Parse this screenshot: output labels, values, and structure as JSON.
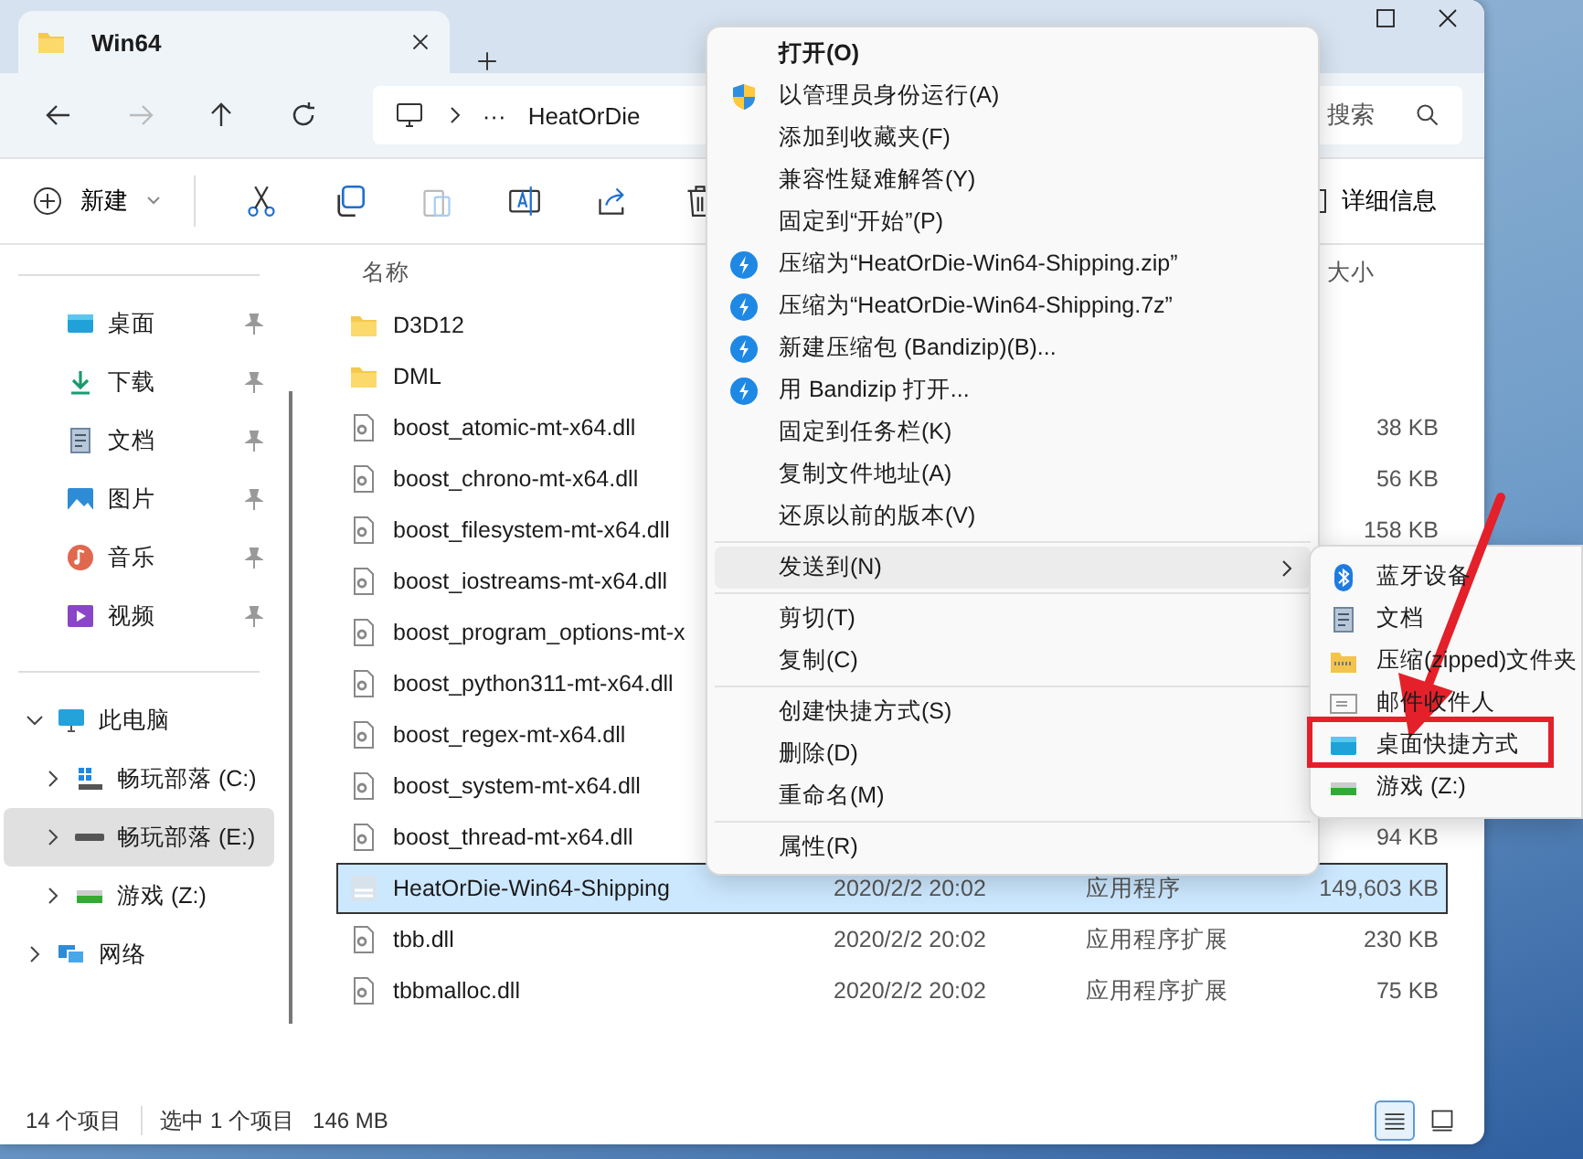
{
  "tabs": [
    {
      "label": "Win64",
      "selected": true
    }
  ],
  "address": {
    "overflow": "···",
    "crumbs": [
      "HeatOrDie"
    ],
    "search_placeholder": "搜索"
  },
  "toolbar": {
    "new_label": "新建",
    "details_label": "详细信息"
  },
  "sidebar": {
    "quick_access": [
      {
        "label": "桌面",
        "kind": "desktop",
        "pinned": true
      },
      {
        "label": "下载",
        "kind": "download",
        "pinned": true
      },
      {
        "label": "文档",
        "kind": "document",
        "pinned": true
      },
      {
        "label": "图片",
        "kind": "picture",
        "pinned": true
      },
      {
        "label": "音乐",
        "kind": "music",
        "pinned": true
      },
      {
        "label": "视频",
        "kind": "video",
        "pinned": true
      }
    ],
    "tree": [
      {
        "label": "此电脑",
        "kind": "pc",
        "expanded": true,
        "selected": false,
        "children": [
          {
            "label": "畅玩部落 (C:)",
            "kind": "windrive",
            "expanded": false,
            "selected": false
          },
          {
            "label": "畅玩部落 (E:)",
            "kind": "drive",
            "expanded": false,
            "selected": true
          },
          {
            "label": "游戏 (Z:)",
            "kind": "netdrive",
            "expanded": false,
            "selected": false
          }
        ]
      },
      {
        "label": "网络",
        "kind": "network",
        "expanded": false,
        "selected": false
      }
    ]
  },
  "file_list": {
    "columns": [
      "名称",
      "大小"
    ],
    "rows": [
      {
        "name": "D3D12",
        "kind": "folder",
        "selected": false
      },
      {
        "name": "DML",
        "kind": "folder",
        "selected": false
      },
      {
        "name": "boost_atomic-mt-x64.dll",
        "kind": "dll",
        "size": "38 KB",
        "selected": false
      },
      {
        "name": "boost_chrono-mt-x64.dll",
        "kind": "dll",
        "size": "56 KB",
        "selected": false
      },
      {
        "name": "boost_filesystem-mt-x64.dll",
        "kind": "dll",
        "size": "158 KB",
        "selected": false
      },
      {
        "name": "boost_iostreams-mt-x64.dll",
        "kind": "dll",
        "selected": false
      },
      {
        "name": "boost_program_options-mt-x",
        "kind": "dll",
        "selected": false
      },
      {
        "name": "boost_python311-mt-x64.dll",
        "kind": "dll",
        "selected": false
      },
      {
        "name": "boost_regex-mt-x64.dll",
        "kind": "dll",
        "selected": false
      },
      {
        "name": "boost_system-mt-x64.dll",
        "kind": "dll",
        "selected": false
      },
      {
        "name": "boost_thread-mt-x64.dll",
        "kind": "dll",
        "size": "94 KB",
        "selected": false
      },
      {
        "name": "HeatOrDie-Win64-Shipping",
        "kind": "exe",
        "date": "2020/2/2 20:02",
        "type": "应用程序",
        "size": "149,603 KB",
        "selected": true
      },
      {
        "name": "tbb.dll",
        "kind": "dll",
        "date": "2020/2/2 20:02",
        "type": "应用程序扩展",
        "size": "230 KB",
        "selected": false
      },
      {
        "name": "tbbmalloc.dll",
        "kind": "dll",
        "date": "2020/2/2 20:02",
        "type": "应用程序扩展",
        "size": "75 KB",
        "selected": false
      }
    ]
  },
  "context_menu": {
    "groups": [
      [
        {
          "label": "打开(O)",
          "kind": "plain",
          "default": true
        },
        {
          "label": "以管理员身份运行(A)",
          "kind": "shield",
          "default": false
        },
        {
          "label": "添加到收藏夹(F)",
          "kind": "plain",
          "default": false
        },
        {
          "label": "兼容性疑难解答(Y)",
          "kind": "plain",
          "default": false
        },
        {
          "label": "固定到“开始”(P)",
          "kind": "plain",
          "default": false
        },
        {
          "label": "压缩为“HeatOrDie-Win64-Shipping.zip”",
          "kind": "bandizip",
          "default": false
        },
        {
          "label": "压缩为“HeatOrDie-Win64-Shipping.7z”",
          "kind": "bandizip",
          "default": false
        },
        {
          "label": "新建压缩包 (Bandizip)(B)...",
          "kind": "bandizip",
          "default": false
        },
        {
          "label": "用 Bandizip 打开...",
          "kind": "bandizip",
          "default": false
        },
        {
          "label": "固定到任务栏(K)",
          "kind": "plain",
          "default": false
        },
        {
          "label": "复制文件地址(A)",
          "kind": "plain",
          "default": false
        },
        {
          "label": "还原以前的版本(V)",
          "kind": "plain",
          "default": false
        }
      ],
      [
        {
          "label": "发送到(N)",
          "kind": "submenu",
          "default": false,
          "selected": true
        }
      ],
      [
        {
          "label": "剪切(T)",
          "kind": "plain",
          "default": false
        },
        {
          "label": "复制(C)",
          "kind": "plain",
          "default": false
        }
      ],
      [
        {
          "label": "创建快捷方式(S)",
          "kind": "plain",
          "default": false
        },
        {
          "label": "删除(D)",
          "kind": "plain",
          "default": false
        },
        {
          "label": "重命名(M)",
          "kind": "plain",
          "default": false
        }
      ],
      [
        {
          "label": "属性(R)",
          "kind": "plain",
          "default": false
        }
      ]
    ]
  },
  "send_to_menu": [
    {
      "label": "蓝牙设备",
      "kind": "bluetooth"
    },
    {
      "label": "文档",
      "kind": "document"
    },
    {
      "label": "压缩(zipped)文件夹",
      "kind": "zip"
    },
    {
      "label": "邮件收件人",
      "kind": "mail"
    },
    {
      "label": "桌面快捷方式",
      "kind": "desktop"
    },
    {
      "label": "游戏 (Z:)",
      "kind": "netdrive"
    }
  ],
  "status_bar": {
    "count": "14 个项目",
    "selection": "选中 1 个项目",
    "size": "146 MB",
    "views": [
      {
        "kind": "details",
        "selected": true
      },
      {
        "kind": "tiles",
        "selected": false
      }
    ]
  }
}
